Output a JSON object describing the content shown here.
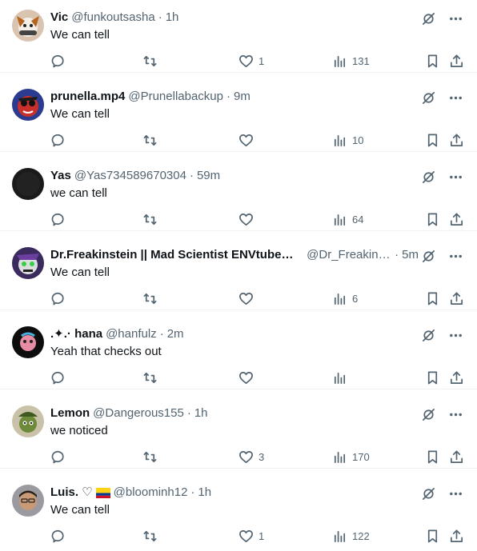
{
  "colors": {
    "text": "#0f1419",
    "muted": "#536471",
    "divider": "#eff3f4"
  },
  "icons": [
    "reply-icon",
    "retweet-icon",
    "heart-icon",
    "views-icon",
    "bookmark-icon",
    "share-icon",
    "grok-icon",
    "more-icon"
  ],
  "replies": [
    {
      "name": "Vic",
      "handle": "@funkoutsasha",
      "dot": "·",
      "time": "1h",
      "text": "We can tell",
      "likes": "1",
      "views": "131"
    },
    {
      "name": "prunella.mp4",
      "handle": "@Prunellabackup",
      "dot": "·",
      "time": "9m",
      "text": "We can tell",
      "likes": "",
      "views": "10"
    },
    {
      "name": "Yas",
      "handle": "@Yas734589670304",
      "dot": "·",
      "time": "59m",
      "text": "we can tell",
      "likes": "",
      "views": "64"
    },
    {
      "name": "Dr.Freakinstein || Mad Scientist ENVtuber 🧪",
      "handle": "@Dr_Freakinstein",
      "dot": "·",
      "time": "5m",
      "text": "We can tell",
      "likes": "",
      "views": "6"
    },
    {
      "name": ".✦.· hana",
      "handle": "@hanfulz",
      "dot": "·",
      "time": "2m",
      "text": "Yeah that checks out",
      "likes": "",
      "views": ""
    },
    {
      "name": "Lemon",
      "handle": "@Dangerous155",
      "dot": "·",
      "time": "1h",
      "text": "we noticed",
      "likes": "3",
      "views": "170"
    },
    {
      "name": "Luis. ♡",
      "handle": "@bloominh12",
      "dot": "·",
      "time": "1h",
      "text": "We can tell",
      "likes": "1",
      "views": "122"
    }
  ]
}
